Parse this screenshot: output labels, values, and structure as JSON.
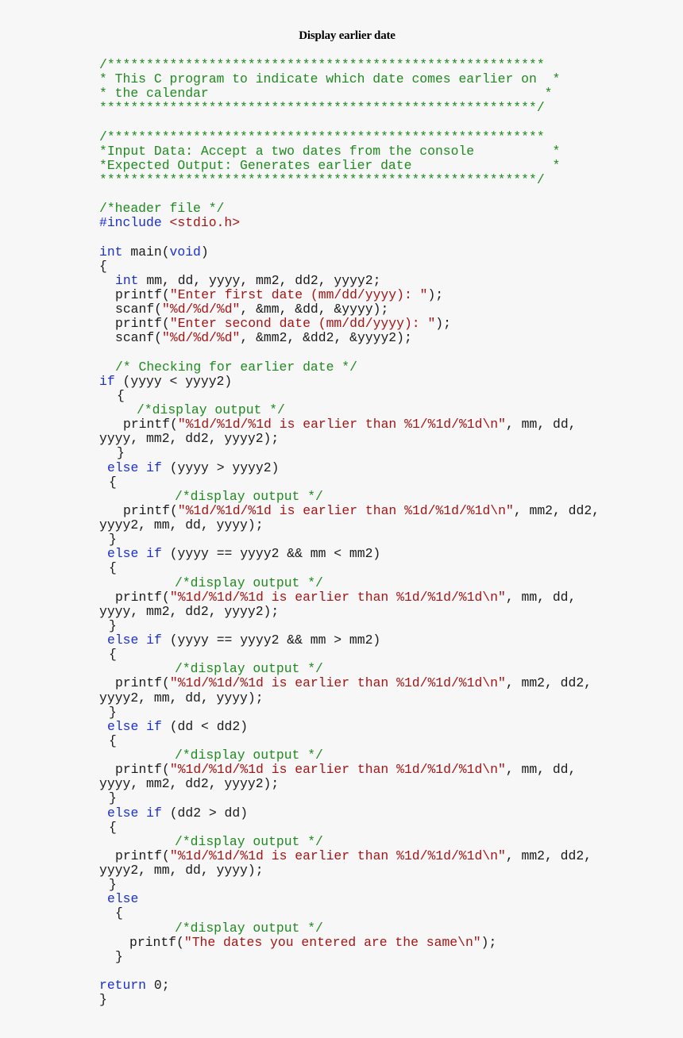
{
  "title": "Display earlier date",
  "colors": {
    "background": "#f7f7f7",
    "comment": "#1f8a1f",
    "keyword": "#1a2fd0",
    "string": "#a31515",
    "plain": "#1a1a1a"
  },
  "lines": [
    {
      "indent": 0,
      "tokens": [
        {
          "t": "c",
          "v": "/********************************************************"
        }
      ]
    },
    {
      "indent": 0,
      "tokens": [
        {
          "t": "c",
          "v": "* This C program to indicate which date comes earlier on  *"
        }
      ]
    },
    {
      "indent": 0,
      "tokens": [
        {
          "t": "c",
          "v": "* the calendar                                           *"
        }
      ]
    },
    {
      "indent": 0,
      "tokens": [
        {
          "t": "c",
          "v": "********************************************************/"
        }
      ]
    },
    {
      "indent": 0,
      "tokens": []
    },
    {
      "indent": 0,
      "tokens": [
        {
          "t": "c",
          "v": "/********************************************************"
        }
      ]
    },
    {
      "indent": 0,
      "tokens": [
        {
          "t": "c",
          "v": "*Input Data: Accept a two dates from the console          *"
        }
      ]
    },
    {
      "indent": 0,
      "tokens": [
        {
          "t": "c",
          "v": "*Expected Output: Generates earlier date                  *"
        }
      ]
    },
    {
      "indent": 0,
      "tokens": [
        {
          "t": "c",
          "v": "********************************************************/"
        }
      ]
    },
    {
      "indent": 0,
      "tokens": []
    },
    {
      "indent": 0,
      "tokens": [
        {
          "t": "c",
          "v": "/*header file */"
        }
      ]
    },
    {
      "indent": 0,
      "tokens": [
        {
          "t": "k",
          "v": "#include "
        },
        {
          "t": "s",
          "v": "<stdio.h>"
        }
      ]
    },
    {
      "indent": 0,
      "tokens": []
    },
    {
      "indent": 0,
      "tokens": [
        {
          "t": "k",
          "v": "int"
        },
        {
          "t": "p",
          "v": " main("
        },
        {
          "t": "k",
          "v": "void"
        },
        {
          "t": "p",
          "v": ")"
        }
      ]
    },
    {
      "indent": 0,
      "tokens": [
        {
          "t": "p",
          "v": "{"
        }
      ]
    },
    {
      "indent": 20,
      "tokens": [
        {
          "t": "k",
          "v": "int"
        },
        {
          "t": "p",
          "v": " mm, dd, yyyy, mm2, dd2, yyyy2;"
        }
      ]
    },
    {
      "indent": 20,
      "tokens": [
        {
          "t": "p",
          "v": "printf("
        },
        {
          "t": "s",
          "v": "\"Enter first date (mm/dd/yyyy): \""
        },
        {
          "t": "p",
          "v": ");"
        }
      ]
    },
    {
      "indent": 20,
      "tokens": [
        {
          "t": "p",
          "v": "scanf("
        },
        {
          "t": "s",
          "v": "\"%d/%d/%d\""
        },
        {
          "t": "p",
          "v": ", &mm, &dd, &yyyy);"
        }
      ]
    },
    {
      "indent": 20,
      "tokens": [
        {
          "t": "p",
          "v": "printf("
        },
        {
          "t": "s",
          "v": "\"Enter second date (mm/dd/yyyy): \""
        },
        {
          "t": "p",
          "v": ");"
        }
      ]
    },
    {
      "indent": 20,
      "tokens": [
        {
          "t": "p",
          "v": "scanf("
        },
        {
          "t": "s",
          "v": "\"%d/%d/%d\""
        },
        {
          "t": "p",
          "v": ", &mm2, &dd2, &yyyy2);"
        }
      ]
    },
    {
      "indent": 0,
      "tokens": []
    },
    {
      "indent": 20,
      "tokens": [
        {
          "t": "c",
          "v": "/* Checking for earlier date */"
        }
      ]
    },
    {
      "indent": 0,
      "tokens": [
        {
          "t": "k",
          "v": "if"
        },
        {
          "t": "p",
          "v": " (yyyy < yyyy2)"
        }
      ]
    },
    {
      "indent": 22,
      "tokens": [
        {
          "t": "p",
          "v": "{"
        }
      ]
    },
    {
      "indent": 47,
      "tokens": [
        {
          "t": "c",
          "v": "/*display output */"
        }
      ]
    },
    {
      "indent": 30,
      "tokens": [
        {
          "t": "p",
          "v": "printf("
        },
        {
          "t": "s",
          "v": "\"%1d/%1d/%1d is earlier than %1/%1d/%1d\\n\""
        },
        {
          "t": "p",
          "v": ", mm, dd,"
        }
      ]
    },
    {
      "indent": 0,
      "tokens": [
        {
          "t": "p",
          "v": "yyyy, mm2, dd2, yyyy2);"
        }
      ]
    },
    {
      "indent": 22,
      "tokens": [
        {
          "t": "p",
          "v": "}"
        }
      ]
    },
    {
      "indent": 10,
      "tokens": [
        {
          "t": "k",
          "v": "else if"
        },
        {
          "t": "p",
          "v": " (yyyy > yyyy2)"
        }
      ]
    },
    {
      "indent": 12,
      "tokens": [
        {
          "t": "p",
          "v": "{"
        }
      ]
    },
    {
      "indent": 95,
      "tokens": [
        {
          "t": "c",
          "v": "/*display output */"
        }
      ]
    },
    {
      "indent": 30,
      "tokens": [
        {
          "t": "p",
          "v": "printf("
        },
        {
          "t": "s",
          "v": "\"%1d/%1d/%1d is earlier than %1d/%1d/%1d\\n\""
        },
        {
          "t": "p",
          "v": ", mm2, dd2,"
        }
      ]
    },
    {
      "indent": 0,
      "tokens": [
        {
          "t": "p",
          "v": "yyyy2, mm, dd, yyyy);"
        }
      ]
    },
    {
      "indent": 12,
      "tokens": [
        {
          "t": "p",
          "v": "}"
        }
      ]
    },
    {
      "indent": 10,
      "tokens": [
        {
          "t": "k",
          "v": "else if"
        },
        {
          "t": "p",
          "v": " (yyyy == yyyy2 && mm < mm2)"
        }
      ]
    },
    {
      "indent": 12,
      "tokens": [
        {
          "t": "p",
          "v": "{"
        }
      ]
    },
    {
      "indent": 95,
      "tokens": [
        {
          "t": "c",
          "v": "/*display output */"
        }
      ]
    },
    {
      "indent": 20,
      "tokens": [
        {
          "t": "p",
          "v": "printf("
        },
        {
          "t": "s",
          "v": "\"%1d/%1d/%1d is earlier than %1d/%1d/%1d\\n\""
        },
        {
          "t": "p",
          "v": ", mm, dd,"
        }
      ]
    },
    {
      "indent": 0,
      "tokens": [
        {
          "t": "p",
          "v": "yyyy, mm2, dd2, yyyy2);"
        }
      ]
    },
    {
      "indent": 12,
      "tokens": [
        {
          "t": "p",
          "v": "}"
        }
      ]
    },
    {
      "indent": 10,
      "tokens": [
        {
          "t": "k",
          "v": "else if"
        },
        {
          "t": "p",
          "v": " (yyyy == yyyy2 && mm > mm2)"
        }
      ]
    },
    {
      "indent": 12,
      "tokens": [
        {
          "t": "p",
          "v": "{"
        }
      ]
    },
    {
      "indent": 95,
      "tokens": [
        {
          "t": "c",
          "v": "/*display output */"
        }
      ]
    },
    {
      "indent": 20,
      "tokens": [
        {
          "t": "p",
          "v": "printf("
        },
        {
          "t": "s",
          "v": "\"%1d/%1d/%1d is earlier than %1d/%1d/%1d\\n\""
        },
        {
          "t": "p",
          "v": ", mm2, dd2,"
        }
      ]
    },
    {
      "indent": 0,
      "tokens": [
        {
          "t": "p",
          "v": "yyyy2, mm, dd, yyyy);"
        }
      ]
    },
    {
      "indent": 12,
      "tokens": [
        {
          "t": "p",
          "v": "}"
        }
      ]
    },
    {
      "indent": 10,
      "tokens": [
        {
          "t": "k",
          "v": "else if"
        },
        {
          "t": "p",
          "v": " (dd < dd2)"
        }
      ]
    },
    {
      "indent": 12,
      "tokens": [
        {
          "t": "p",
          "v": "{"
        }
      ]
    },
    {
      "indent": 95,
      "tokens": [
        {
          "t": "c",
          "v": "/*display output */"
        }
      ]
    },
    {
      "indent": 20,
      "tokens": [
        {
          "t": "p",
          "v": "printf("
        },
        {
          "t": "s",
          "v": "\"%1d/%1d/%1d is earlier than %1d/%1d/%1d\\n\""
        },
        {
          "t": "p",
          "v": ", mm, dd,"
        }
      ]
    },
    {
      "indent": 0,
      "tokens": [
        {
          "t": "p",
          "v": "yyyy, mm2, dd2, yyyy2);"
        }
      ]
    },
    {
      "indent": 12,
      "tokens": [
        {
          "t": "p",
          "v": "}"
        }
      ]
    },
    {
      "indent": 10,
      "tokens": [
        {
          "t": "k",
          "v": "else if"
        },
        {
          "t": "p",
          "v": " (dd2 > dd)"
        }
      ]
    },
    {
      "indent": 12,
      "tokens": [
        {
          "t": "p",
          "v": "{"
        }
      ]
    },
    {
      "indent": 95,
      "tokens": [
        {
          "t": "c",
          "v": "/*display output */"
        }
      ]
    },
    {
      "indent": 20,
      "tokens": [
        {
          "t": "p",
          "v": "printf("
        },
        {
          "t": "s",
          "v": "\"%1d/%1d/%1d is earlier than %1d/%1d/%1d\\n\""
        },
        {
          "t": "p",
          "v": ", mm2, dd2,"
        }
      ]
    },
    {
      "indent": 0,
      "tokens": [
        {
          "t": "p",
          "v": "yyyy2, mm, dd, yyyy);"
        }
      ]
    },
    {
      "indent": 12,
      "tokens": [
        {
          "t": "p",
          "v": "}"
        }
      ]
    },
    {
      "indent": 10,
      "tokens": [
        {
          "t": "k",
          "v": "else"
        }
      ]
    },
    {
      "indent": 20,
      "tokens": [
        {
          "t": "p",
          "v": "{"
        }
      ]
    },
    {
      "indent": 95,
      "tokens": [
        {
          "t": "c",
          "v": "/*display output */"
        }
      ]
    },
    {
      "indent": 38,
      "tokens": [
        {
          "t": "p",
          "v": "printf("
        },
        {
          "t": "s",
          "v": "\"The dates you entered are the same\\n\""
        },
        {
          "t": "p",
          "v": ");"
        }
      ]
    },
    {
      "indent": 20,
      "tokens": [
        {
          "t": "p",
          "v": "}"
        }
      ]
    },
    {
      "indent": 0,
      "tokens": []
    },
    {
      "indent": 0,
      "tokens": [
        {
          "t": "k",
          "v": "return"
        },
        {
          "t": "p",
          "v": " 0;"
        }
      ]
    },
    {
      "indent": 0,
      "tokens": [
        {
          "t": "p",
          "v": "}"
        }
      ]
    }
  ]
}
